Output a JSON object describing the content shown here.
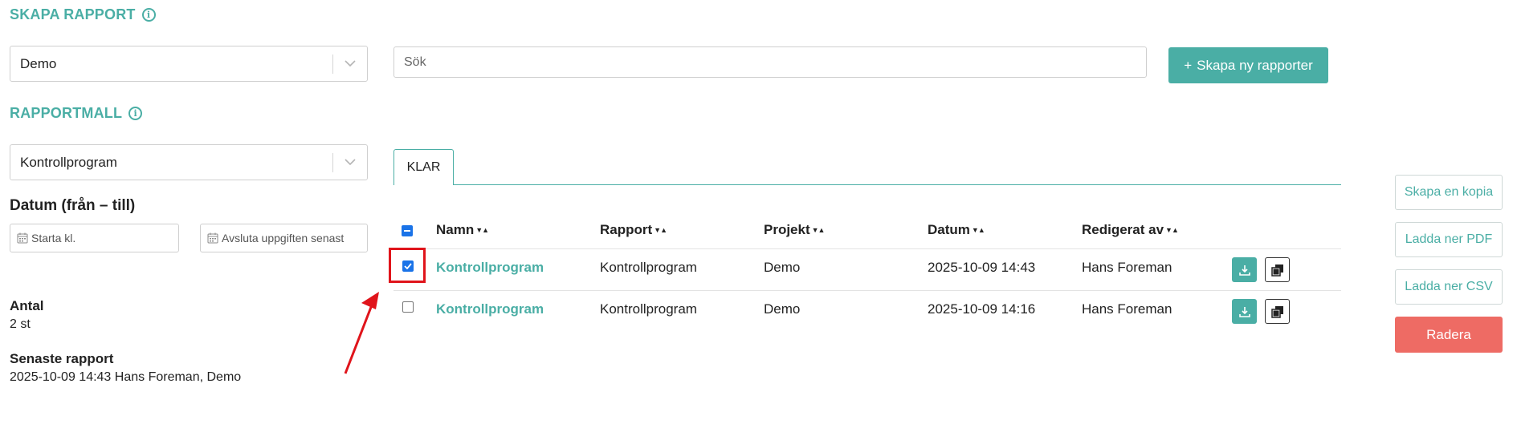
{
  "create_report": {
    "title": "SKAPA RAPPORT",
    "project_select": "Demo",
    "template_title": "RAPPORTMALL",
    "template_select": "Kontrollprogram",
    "date_title": "Datum (från – till)",
    "start_placeholder": "Starta kl.",
    "end_placeholder": "Avsluta uppgiften senast"
  },
  "stats": {
    "count_label": "Antal",
    "count_value": "2 st",
    "latest_label": "Senaste rapport",
    "latest_value": "2025-10-09 14:43 Hans Foreman, Demo"
  },
  "search": {
    "placeholder": "Sök"
  },
  "create_button": {
    "icon": "+",
    "label": "Skapa ny rapporter"
  },
  "tabs": [
    {
      "label": "KLAR"
    }
  ],
  "table": {
    "headers": [
      "Namn",
      "Rapport",
      "Projekt",
      "Datum",
      "Redigerat av"
    ],
    "rows": [
      {
        "name": "Kontrollprogram",
        "report": "Kontrollprogram",
        "project": "Demo",
        "date": "2025-10-09 14:43",
        "edited_by": "Hans Foreman",
        "checked": true
      },
      {
        "name": "Kontrollprogram",
        "report": "Kontrollprogram",
        "project": "Demo",
        "date": "2025-10-09 14:16",
        "edited_by": "Hans Foreman",
        "checked": false
      }
    ]
  },
  "actions": {
    "copy": "Skapa en kopia",
    "pdf": "Ladda ner PDF",
    "csv": "Ladda ner CSV",
    "delete": "Radera"
  },
  "colors": {
    "accent": "#4aaea5",
    "danger": "#ee6b64",
    "highlight": "#e0141b"
  }
}
